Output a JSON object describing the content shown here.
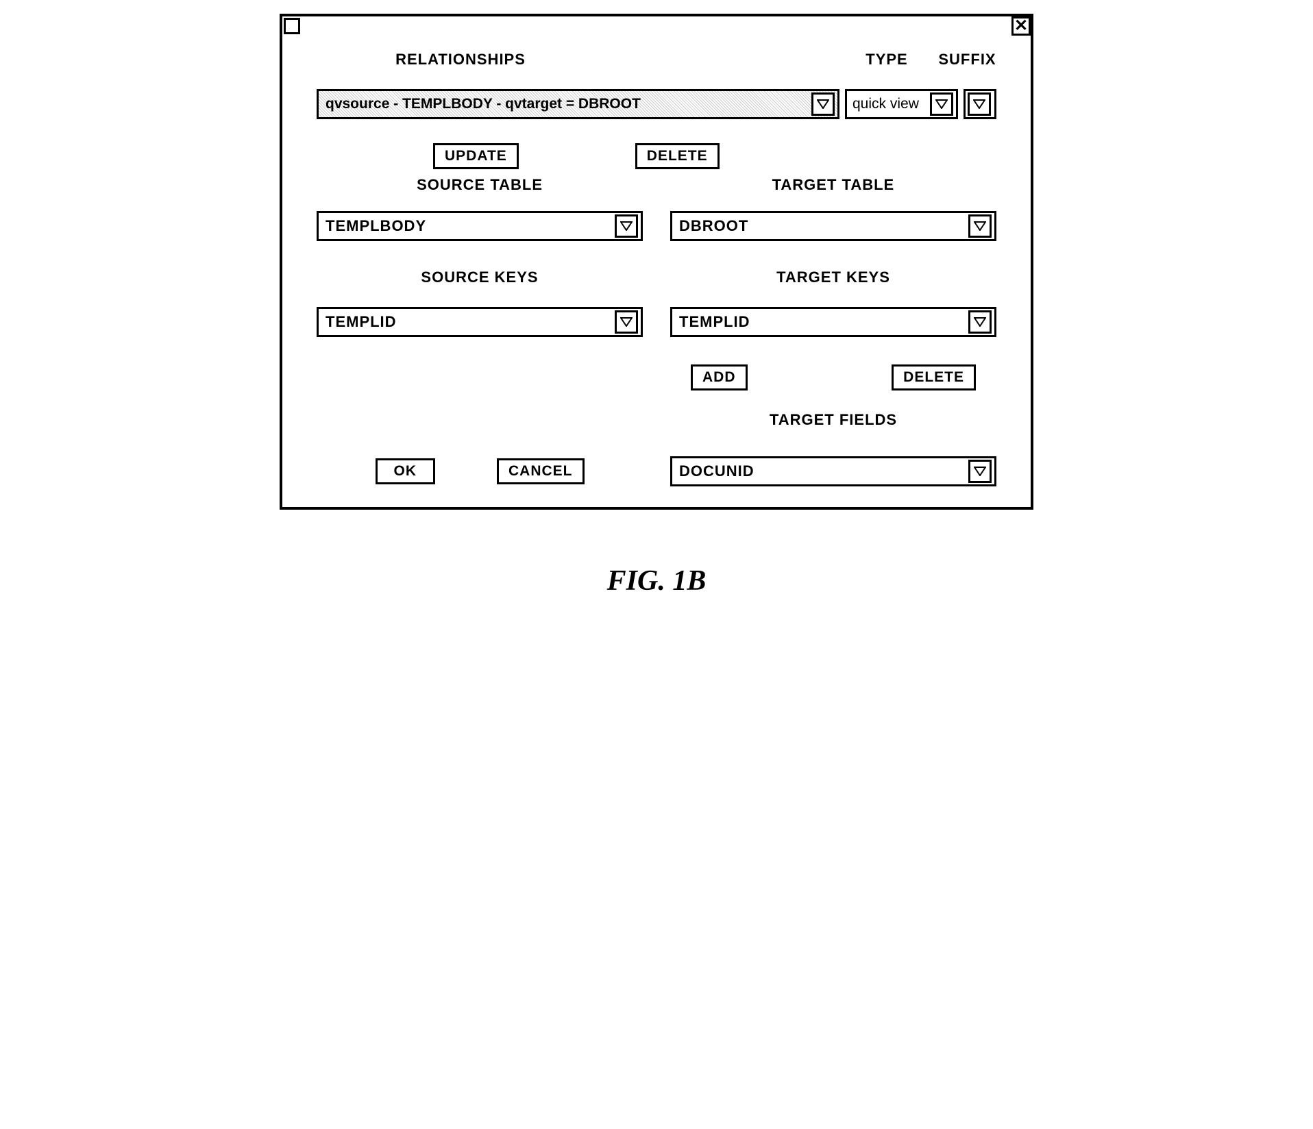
{
  "headers": {
    "relationships": "RELATIONSHIPS",
    "type": "TYPE",
    "suffix": "SUFFIX"
  },
  "relationships_dropdown": {
    "value": "qvsource - TEMPLBODY - qvtarget = DBROOT"
  },
  "type_dropdown": {
    "value": "quick view"
  },
  "buttons": {
    "update": "UPDATE",
    "delete": "DELETE",
    "add": "ADD",
    "delete2": "DELETE",
    "ok": "OK",
    "cancel": "CANCEL"
  },
  "labels": {
    "source_table": "SOURCE TABLE",
    "target_table": "TARGET TABLE",
    "source_keys": "SOURCE KEYS",
    "target_keys": "TARGET KEYS",
    "target_fields": "TARGET FIELDS"
  },
  "source_table": {
    "value": "TEMPLBODY"
  },
  "target_table": {
    "value": "DBROOT"
  },
  "source_keys": {
    "value": "TEMPLID"
  },
  "target_keys": {
    "value": "TEMPLID"
  },
  "target_fields": {
    "value": "DOCUNID"
  },
  "figure_caption": "FIG.  1B"
}
